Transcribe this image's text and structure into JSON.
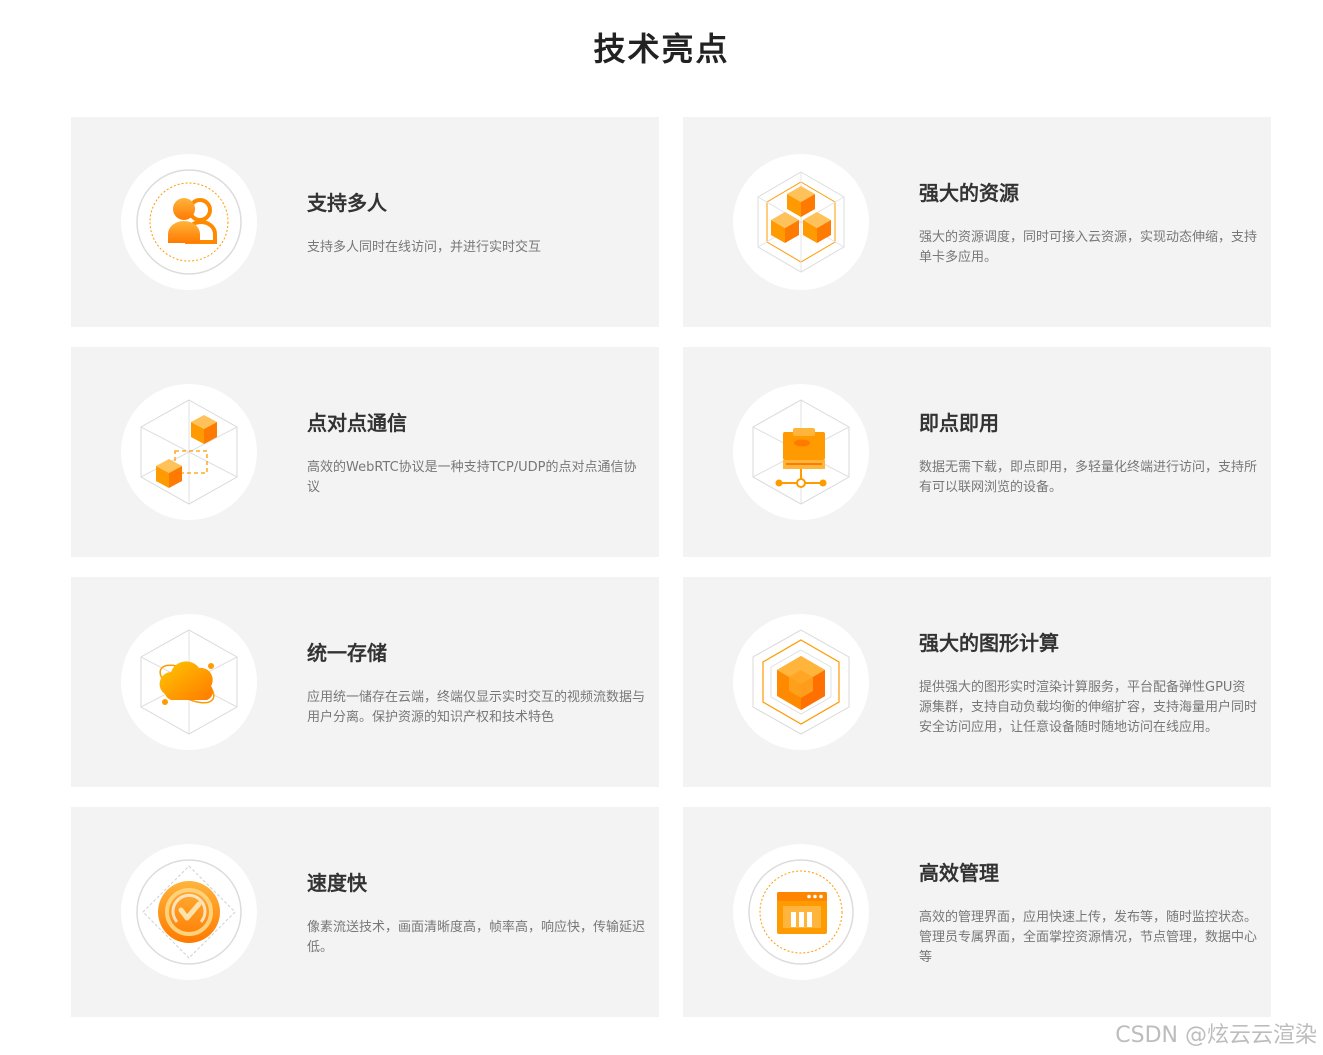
{
  "page": {
    "title": "技术亮点"
  },
  "features": [
    {
      "id": "multi-user",
      "icon": "users-icon",
      "title": "支持多人",
      "desc": "支持多人同时在线访问，并进行实时交互"
    },
    {
      "id": "resources",
      "icon": "cubes-icon",
      "title": "强大的资源",
      "desc": "强大的资源调度，同时可接入云资源，实现动态伸缩，支持单卡多应用。"
    },
    {
      "id": "p2p",
      "icon": "p2p-cubes-icon",
      "title": "点对点通信",
      "desc": "高效的WebRTC协议是一种支持TCP/UDP的点对点通信协议"
    },
    {
      "id": "instant-use",
      "icon": "server-network-icon",
      "title": "即点即用",
      "desc": "数据无需下载，即点即用，多轻量化终端进行访问，支持所有可以联网浏览的设备。"
    },
    {
      "id": "storage",
      "icon": "cloud-storage-icon",
      "title": "统一存储",
      "desc": "应用统一储存在云端，终端仅显示实时交互的视频流数据与用户分离。保护资源的知识产权和技术特色"
    },
    {
      "id": "graphics",
      "icon": "hexagon-cube-icon",
      "title": "强大的图形计算",
      "desc": "提供强大的图形实时渲染计算服务，平台配备弹性GPU资源集群，支持自动负载均衡的伸缩扩容，支持海量用户同时安全访问应用，让任意设备随时随地访问在线应用。"
    },
    {
      "id": "speed",
      "icon": "speedometer-icon",
      "title": "速度快",
      "desc": "像素流送技术，画面清晰度高，帧率高，响应快，传输延迟低。"
    },
    {
      "id": "management",
      "icon": "dashboard-window-icon",
      "title": "高效管理",
      "desc": "高效的管理界面，应用快速上传，发布等，随时监控状态。管理员专属界面，全面掌控资源情况，节点管理，数据中心等"
    }
  ],
  "watermark": "CSDN @炫云云渲染",
  "colors": {
    "accent": "#ff9a00",
    "accent_dark": "#ff7a00",
    "card_bg": "#f3f3f3",
    "title": "#333333",
    "desc": "#777777"
  }
}
